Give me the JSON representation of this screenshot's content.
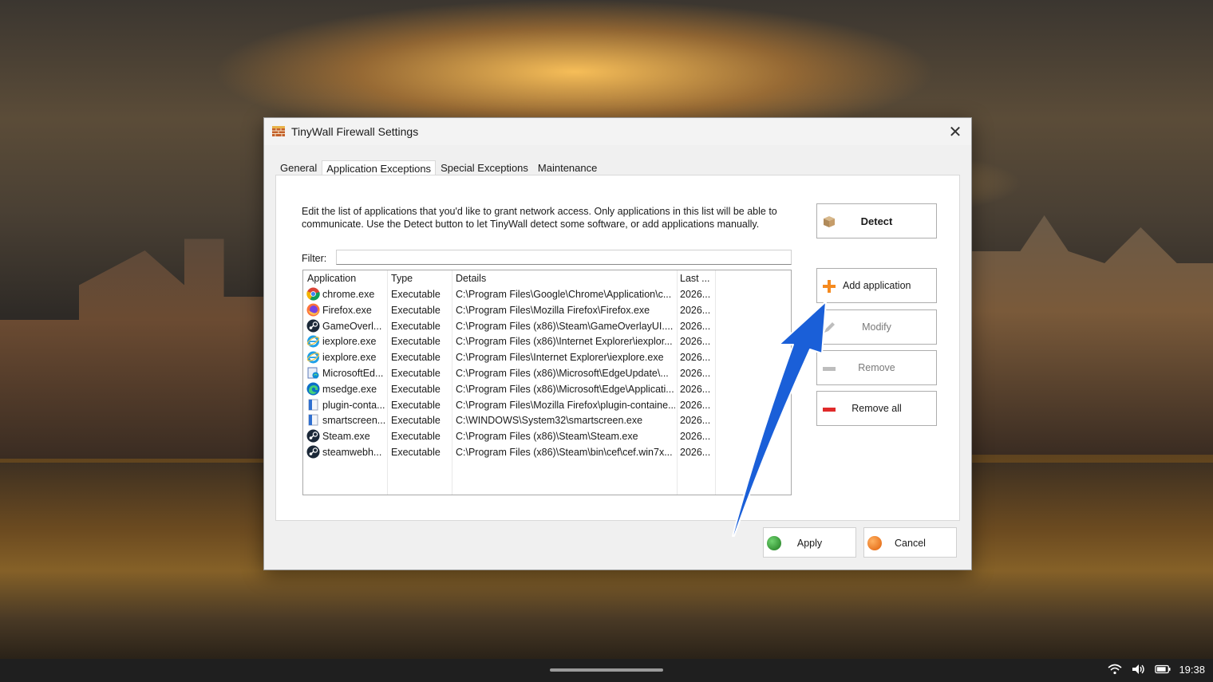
{
  "window": {
    "title": "TinyWall Firewall Settings",
    "close_glyph": "✕"
  },
  "tabs": [
    {
      "label": "General",
      "active": false
    },
    {
      "label": "Application Exceptions",
      "active": true
    },
    {
      "label": "Special Exceptions",
      "active": false
    },
    {
      "label": "Maintenance",
      "active": false
    }
  ],
  "panel": {
    "description": "Edit the list of applications that you'd like to grant network access. Only applications in this list will be able to communicate. Use the Detect button to let TinyWall detect some software, or add applications manually.",
    "filter_label": "Filter:",
    "filter_value": ""
  },
  "list": {
    "columns": [
      "Application",
      "Type",
      "Details",
      "Last ..."
    ],
    "rows": [
      {
        "app": "chrome.exe",
        "type": "Executable",
        "details": "C:\\Program Files\\Google\\Chrome\\Application\\c...",
        "last": "2026...",
        "icon": "chrome-icon"
      },
      {
        "app": "Firefox.exe",
        "type": "Executable",
        "details": "C:\\Program Files\\Mozilla Firefox\\Firefox.exe",
        "last": "2026...",
        "icon": "firefox-icon"
      },
      {
        "app": "GameOverl...",
        "type": "Executable",
        "details": "C:\\Program Files (x86)\\Steam\\GameOverlayUI....",
        "last": "2026...",
        "icon": "steam-icon"
      },
      {
        "app": "iexplore.exe",
        "type": "Executable",
        "details": "C:\\Program Files (x86)\\Internet Explorer\\iexplor...",
        "last": "2026...",
        "icon": "ie-icon"
      },
      {
        "app": "iexplore.exe",
        "type": "Executable",
        "details": "C:\\Program Files\\Internet Explorer\\iexplore.exe",
        "last": "2026...",
        "icon": "ie-icon"
      },
      {
        "app": "MicrosoftEd...",
        "type": "Executable",
        "details": "C:\\Program Files (x86)\\Microsoft\\EdgeUpdate\\...",
        "last": "2026...",
        "icon": "edge-update-icon"
      },
      {
        "app": "msedge.exe",
        "type": "Executable",
        "details": "C:\\Program Files (x86)\\Microsoft\\Edge\\Applicati...",
        "last": "2026...",
        "icon": "edge-icon"
      },
      {
        "app": "plugin-conta...",
        "type": "Executable",
        "details": "C:\\Program Files\\Mozilla Firefox\\plugin-containe...",
        "last": "2026...",
        "icon": "generic-exe-icon"
      },
      {
        "app": "smartscreen...",
        "type": "Executable",
        "details": "C:\\WINDOWS\\System32\\smartscreen.exe",
        "last": "2026...",
        "icon": "generic-exe-icon"
      },
      {
        "app": "Steam.exe",
        "type": "Executable",
        "details": "C:\\Program Files (x86)\\Steam\\Steam.exe",
        "last": "2026...",
        "icon": "steam-icon"
      },
      {
        "app": "steamwebh...",
        "type": "Executable",
        "details": "C:\\Program Files (x86)\\Steam\\bin\\cef\\cef.win7x...",
        "last": "2026...",
        "icon": "steam-icon"
      }
    ]
  },
  "buttons": {
    "detect": "Detect",
    "add_application": "Add application",
    "modify": "Modify",
    "remove": "Remove",
    "remove_all": "Remove all",
    "apply": "Apply",
    "cancel": "Cancel"
  },
  "taskbar": {
    "clock": "19:38"
  },
  "colors": {
    "annotation_arrow": "#1a5fd8",
    "apply_icon": "#2e8b2e",
    "cancel_icon": "#f07a1a",
    "add_icon": "#f58a1f",
    "remove_all_icon": "#e02a2a"
  }
}
